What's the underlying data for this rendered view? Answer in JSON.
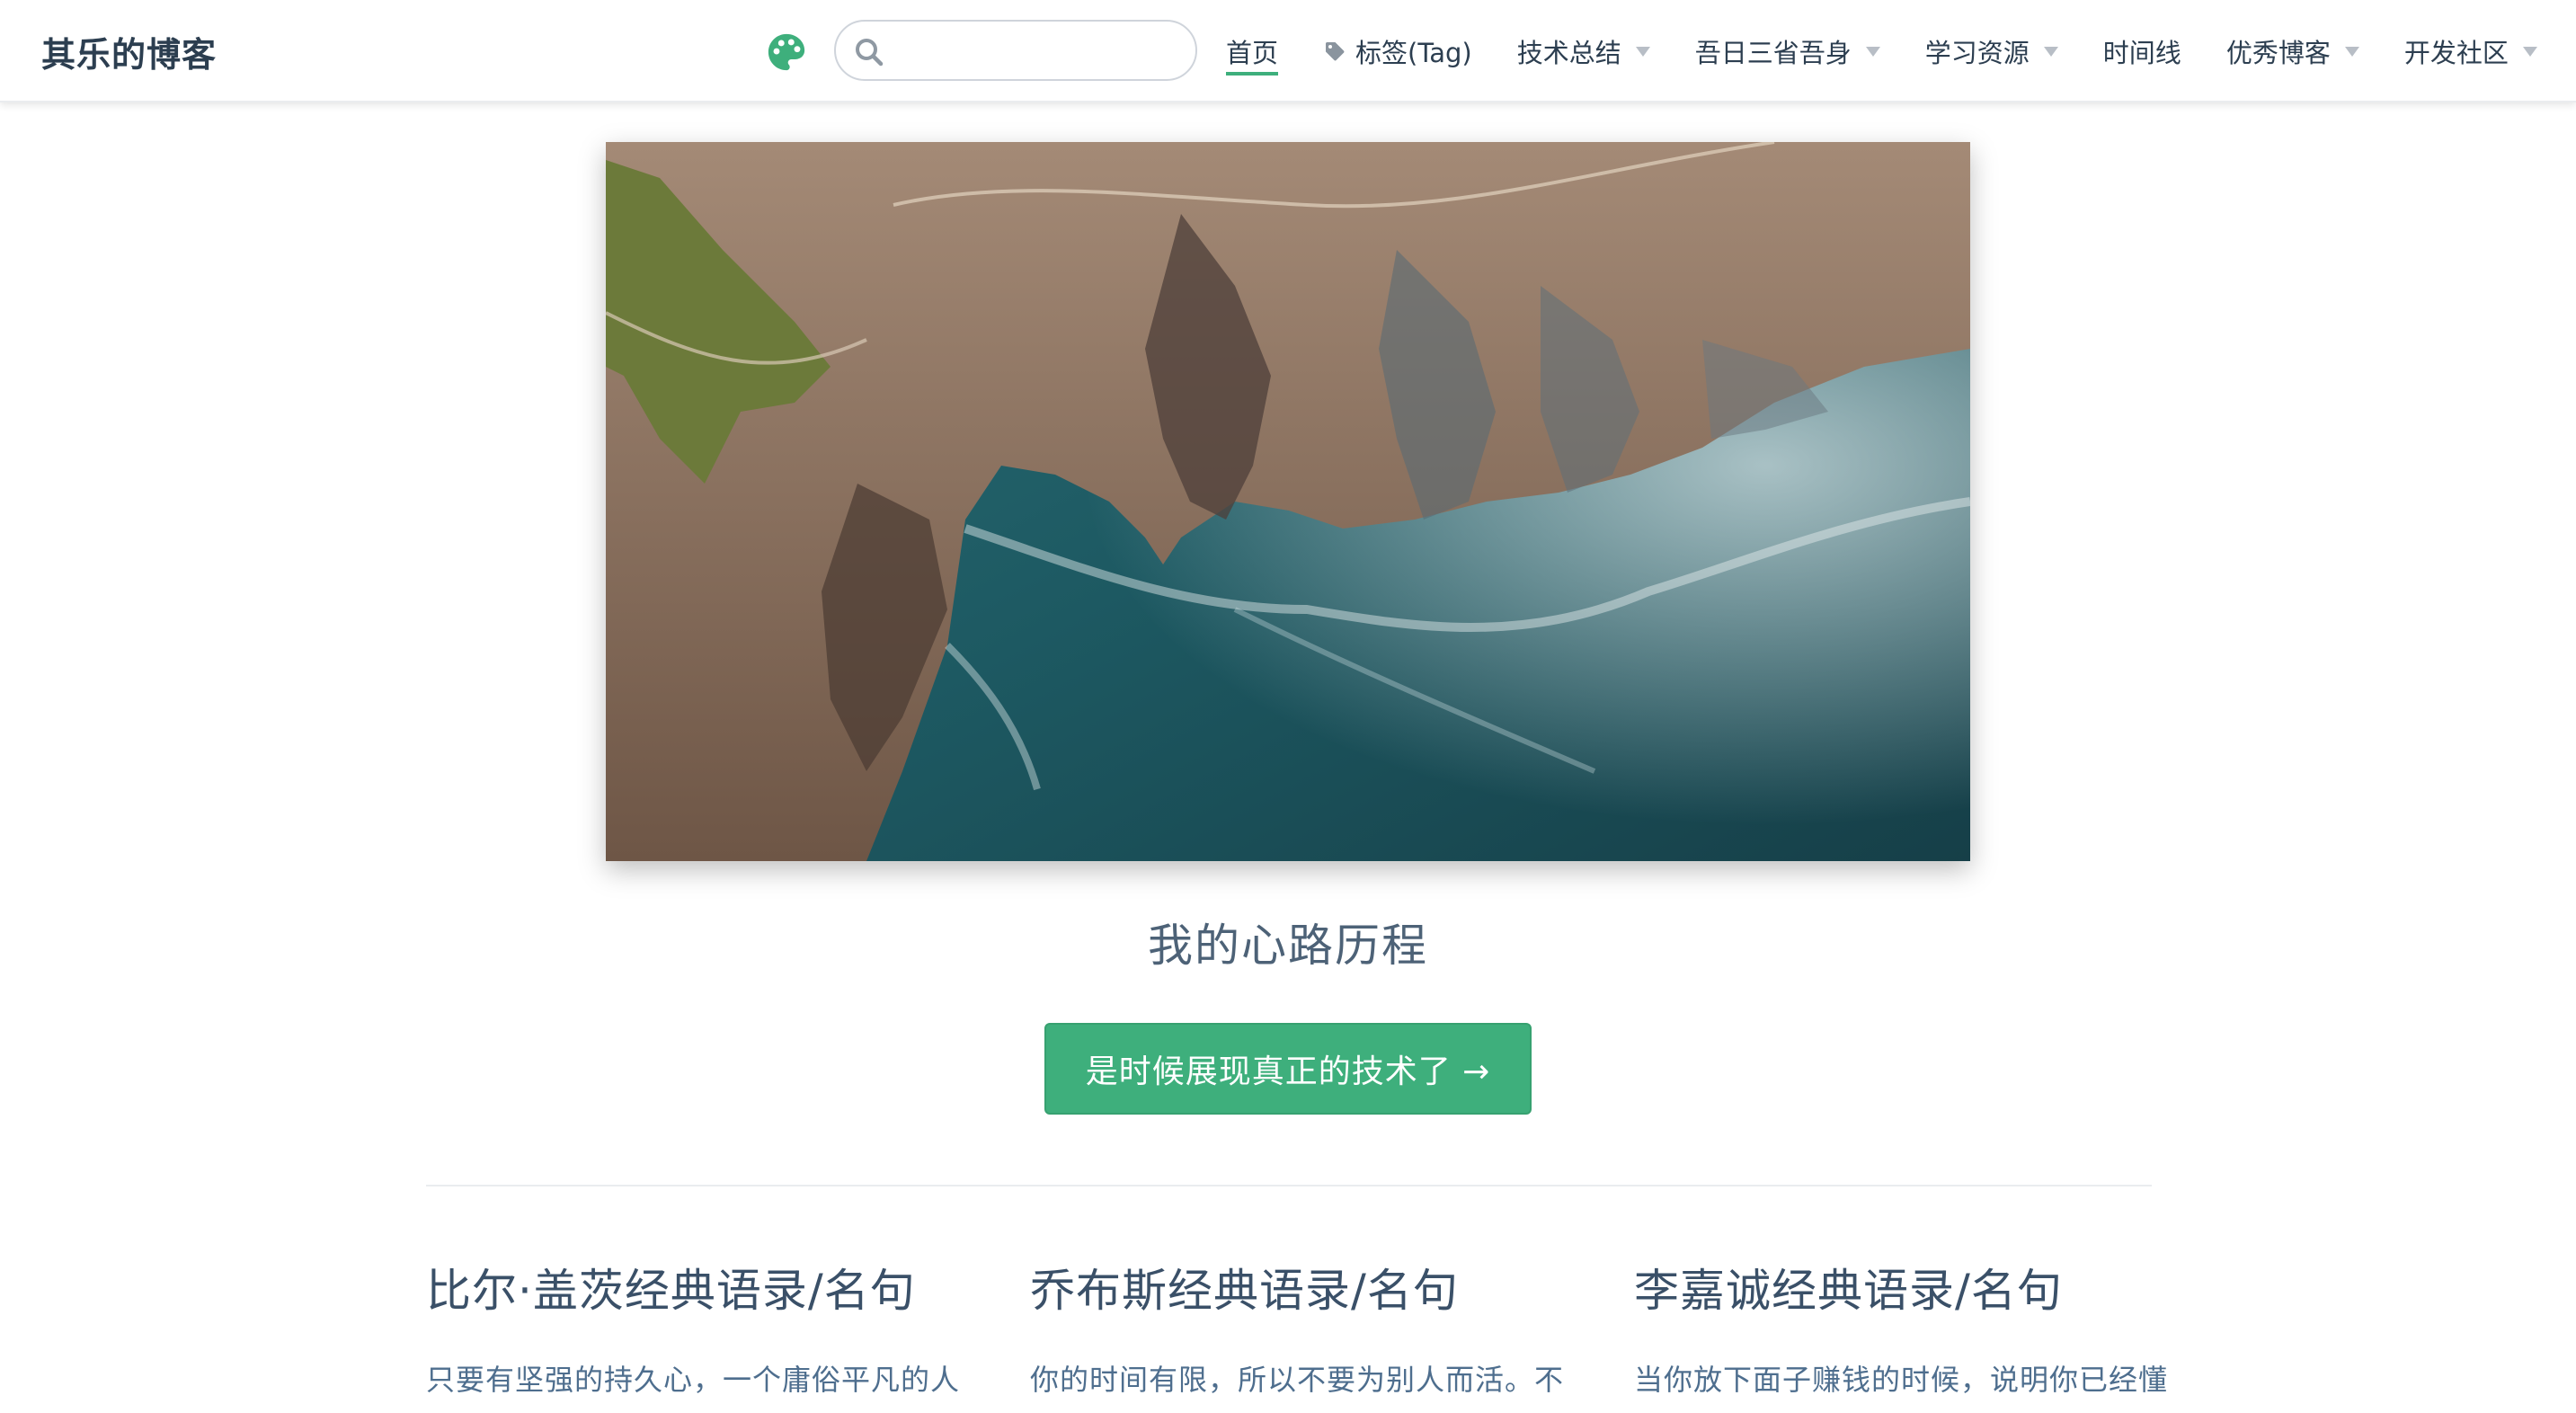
{
  "site": {
    "name": "其乐的博客"
  },
  "search": {
    "placeholder": "",
    "value": ""
  },
  "nav": {
    "items": [
      {
        "label": "首页",
        "active": true,
        "dropdown": false
      },
      {
        "label": "标签(Tag)",
        "icon": "tag-icon",
        "dropdown": false
      },
      {
        "label": "技术总结",
        "dropdown": true
      },
      {
        "label": "吾日三省吾身",
        "dropdown": true
      },
      {
        "label": "学习资源",
        "dropdown": true
      },
      {
        "label": "时间线",
        "dropdown": false
      },
      {
        "label": "优秀博客",
        "dropdown": true
      },
      {
        "label": "开发社区",
        "dropdown": true
      }
    ]
  },
  "hero": {
    "image": "aerial-coastline-cliffs",
    "description": "我的心路历程",
    "action_label": "是时候展现真正的技术了 →"
  },
  "features": [
    {
      "title": "比尔·盖茨经典语录/名句",
      "details": "只要有坚强的持久心，一个庸俗平凡的人"
    },
    {
      "title": "乔布斯经典语录/名句",
      "details": "你的时间有限，所以不要为别人而活。不"
    },
    {
      "title": "李嘉诚经典语录/名句",
      "details": "当你放下面子赚钱的时候，说明你已经懂"
    }
  ],
  "colors": {
    "accent": "#3eaf7c",
    "text": "#2c3e50",
    "muted": "#4e6e8e"
  }
}
